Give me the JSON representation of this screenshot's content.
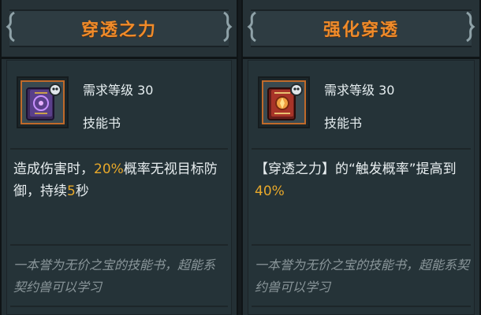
{
  "cards": [
    {
      "title": "穿透之力",
      "requirement": "需求等级 30",
      "item_type": "技能书",
      "description": {
        "part1": "造成伤害时，",
        "value1": "20%",
        "part2": "概率无视目标防御，持续",
        "value2": "5",
        "part3": "秒"
      },
      "flavor": "一本誉为无价之宝的技能书，超能系契约兽可以学习",
      "icon": "purple-skill-book-icon"
    },
    {
      "title": "强化穿透",
      "requirement": "需求等级 30",
      "item_type": "技能书",
      "description": {
        "part1": "【穿透之力】的“触发概率”提高到",
        "value1": "40%"
      },
      "flavor": "一本誉为无价之宝的技能书，超能系契约兽可以学习",
      "icon": "red-skill-book-icon"
    }
  ],
  "colors": {
    "title": "#f08b2a",
    "highlight": "#e8a82a",
    "text": "#e8eef0",
    "flavor": "#8a969a",
    "panel": "#243035"
  }
}
